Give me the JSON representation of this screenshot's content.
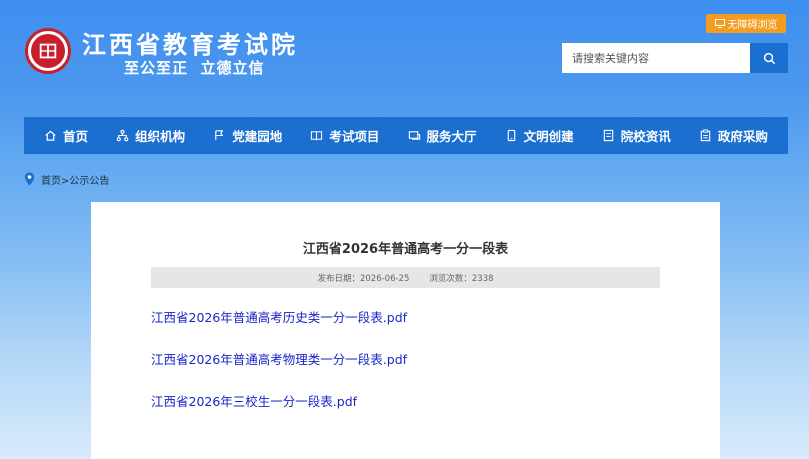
{
  "header": {
    "site_title": "江西省教育考试院",
    "slogan": "至公至正  立德立信",
    "barrier_free_label": "无障碍浏览",
    "search_placeholder": "请搜索关键内容"
  },
  "nav": {
    "items": [
      {
        "label": "首页",
        "icon": "home-icon"
      },
      {
        "label": "组织机构",
        "icon": "org-icon"
      },
      {
        "label": "党建园地",
        "icon": "party-icon"
      },
      {
        "label": "考试项目",
        "icon": "book-icon"
      },
      {
        "label": "服务大厅",
        "icon": "service-icon"
      },
      {
        "label": "文明创建",
        "icon": "phone-icon"
      },
      {
        "label": "院校资讯",
        "icon": "news-icon"
      },
      {
        "label": "政府采购",
        "icon": "clipboard-icon"
      }
    ]
  },
  "breadcrumb": {
    "text": "首页>公示公告"
  },
  "article": {
    "title": "江西省2026年普通高考一分一段表",
    "publish_date": "发布日期：2026-06-25",
    "views": "浏览次数：2338",
    "files": [
      "江西省2026年普通高考历史类一分一段表.pdf",
      "江西省2026年普通高考物理类一分一段表.pdf",
      "江西省2026年三校生一分一段表.pdf"
    ]
  },
  "colors": {
    "nav_bg": "#1a6fd1",
    "accent_orange": "#f39c1f",
    "logo_red": "#c8202a",
    "link_blue": "#1a26c9"
  }
}
